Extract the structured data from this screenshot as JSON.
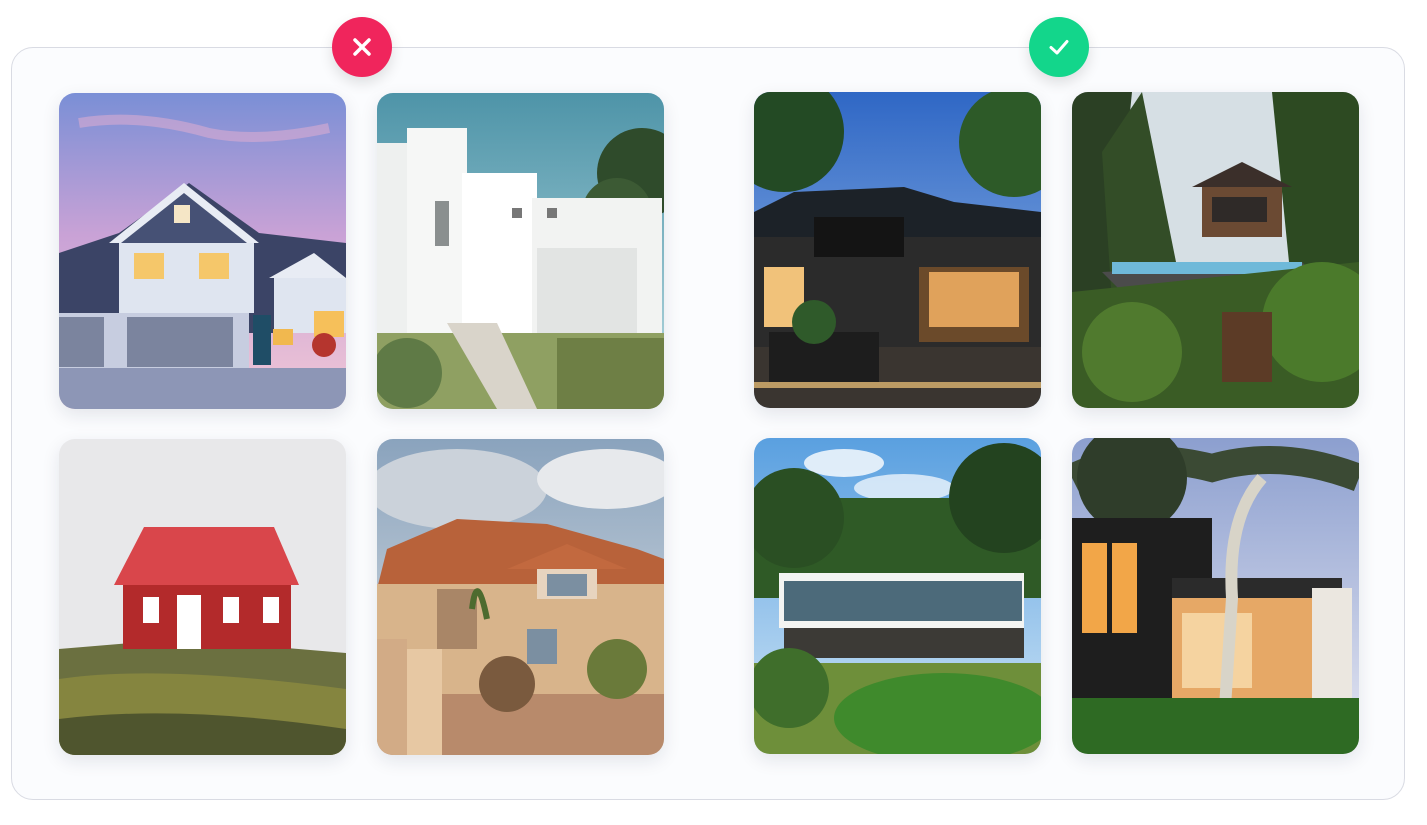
{
  "comparison": {
    "bad_group": {
      "indicator_icon": "close-icon",
      "indicator_color": "#f0255c",
      "images": [
        {
          "icon": "suburban-house-image"
        },
        {
          "icon": "white-modern-house-image"
        },
        {
          "icon": "red-cabin-image"
        },
        {
          "icon": "mediterranean-villa-image"
        }
      ]
    },
    "good_group": {
      "indicator_icon": "check-icon",
      "indicator_color": "#13d68b",
      "images": [
        {
          "icon": "lit-restaurant-house-image"
        },
        {
          "icon": "forest-treehouse-pool-image"
        },
        {
          "icon": "glass-house-forest-image"
        },
        {
          "icon": "modern-house-tree-night-image"
        }
      ]
    }
  }
}
